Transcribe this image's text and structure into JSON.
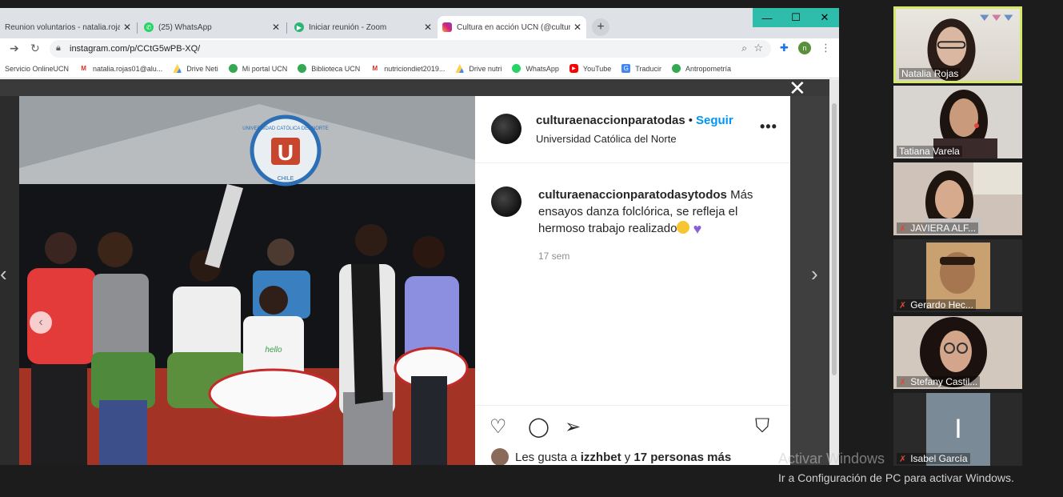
{
  "browser": {
    "tabs": [
      {
        "title": "Reunion voluntarios - natalia.rojas",
        "icon": "gmail-icon"
      },
      {
        "title": "(25) WhatsApp",
        "icon": "whatsapp-icon"
      },
      {
        "title": "Iniciar reunión - Zoom",
        "icon": "zoom-icon"
      },
      {
        "title": "Cultura en acción UCN (@cultura",
        "icon": "instagram-icon"
      }
    ],
    "url": "instagram.com/p/CCtG5wPB-XQ/",
    "profile_initial": "n",
    "bookmarks": [
      {
        "label": "Servicio OnlineUCN",
        "icon": "none",
        "color": "#ffffff"
      },
      {
        "label": "natalia.rojas01@alu...",
        "icon": "gmail-icon",
        "color": "#d93025"
      },
      {
        "label": "Drive Neti",
        "icon": "drive-icon",
        "color": "#1fa463"
      },
      {
        "label": "Mi portal UCN",
        "icon": "globe-icon",
        "color": "#34a853"
      },
      {
        "label": "Biblioteca UCN",
        "icon": "globe-icon",
        "color": "#34a853"
      },
      {
        "label": "nutriciondiet2019...",
        "icon": "gmail-icon",
        "color": "#d93025"
      },
      {
        "label": "Drive nutri",
        "icon": "drive-icon",
        "color": "#1fa463"
      },
      {
        "label": "WhatsApp",
        "icon": "whatsapp-icon",
        "color": "#25d366"
      },
      {
        "label": "YouTube",
        "icon": "youtube-icon",
        "color": "#ff0000"
      },
      {
        "label": "Traducir",
        "icon": "translate-icon",
        "color": "#4285f4"
      },
      {
        "label": "Antropometría",
        "icon": "globe-icon",
        "color": "#34a853"
      }
    ]
  },
  "post": {
    "username": "culturaenaccionparatodas",
    "dot": "•",
    "follow_label": "Seguir",
    "location": "Universidad Católica del Norte",
    "more_label": "•••",
    "caption_user": "culturaenaccionparatodasytodos",
    "caption_text": "Más ensayos danza folclórica, se refleja el hermoso trabajo realizado",
    "time": "17 sem",
    "likes_prefix": "Les gusta a",
    "likes_user": "izzhbet",
    "likes_mid": "y",
    "likes_count": "17 personas más",
    "photo_banner": "UNIVERSIDAD CATÓLICA DEL NORTE",
    "photo_banner_country": "CHILE",
    "photo_shirt_text": "hello"
  },
  "zoom": {
    "participants": [
      {
        "name": "Natalia Rojas",
        "muted": false,
        "active": true
      },
      {
        "name": "Tatiana Varela",
        "muted": false,
        "active": false
      },
      {
        "name": "JAVIERA ALF...",
        "muted": true,
        "active": false
      },
      {
        "name": "Gerardo Hec...",
        "muted": true,
        "active": false
      },
      {
        "name": "Stefany Castil...",
        "muted": true,
        "active": false
      },
      {
        "name": "Isabel García",
        "muted": true,
        "active": false,
        "initial": "I"
      }
    ]
  },
  "windows": {
    "activate_title": "Activar Windows",
    "activate_sub": "Ir a Configuración de PC para activar Windows."
  },
  "colors": {
    "instagram_blue": "#0095f6",
    "zoom_active_border": "#d6e86a",
    "window_controls": "#2ebdaa"
  }
}
